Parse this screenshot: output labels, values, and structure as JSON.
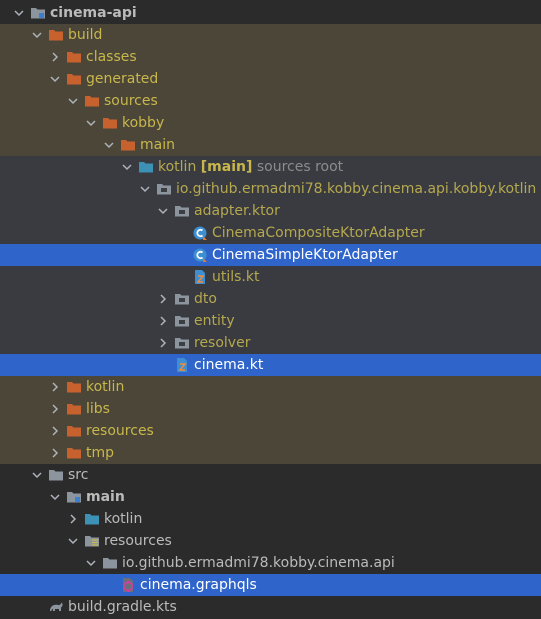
{
  "tree": {
    "root": {
      "label": "cinema-api"
    },
    "build": {
      "label": "build"
    },
    "classes": {
      "label": "classes"
    },
    "generated": {
      "label": "generated"
    },
    "sources": {
      "label": "sources"
    },
    "kobby": {
      "label": "kobby"
    },
    "main_gen": {
      "label": "main"
    },
    "kotlin_gen": {
      "label": "kotlin",
      "tag": "[main]",
      "hint": "sources root"
    },
    "package": {
      "label": "io.github.ermadmi78.kobby.cinema.api.kobby.kotlin"
    },
    "adapter_ktor": {
      "label": "adapter.ktor"
    },
    "composite_adapter": {
      "label": "CinemaCompositeKtorAdapter"
    },
    "simple_adapter": {
      "label": "CinemaSimpleKtorAdapter"
    },
    "utils": {
      "label": "utils.kt"
    },
    "dto": {
      "label": "dto"
    },
    "entity": {
      "label": "entity"
    },
    "resolver": {
      "label": "resolver"
    },
    "cinema_kt": {
      "label": "cinema.kt"
    },
    "kotlin_build": {
      "label": "kotlin"
    },
    "libs": {
      "label": "libs"
    },
    "resources_build": {
      "label": "resources"
    },
    "tmp": {
      "label": "tmp"
    },
    "src": {
      "label": "src"
    },
    "main_src": {
      "label": "main"
    },
    "kotlin_src": {
      "label": "kotlin"
    },
    "resources_src": {
      "label": "resources"
    },
    "res_package": {
      "label": "io.github.ermadmi78.kobby.cinema.api"
    },
    "graphqls": {
      "label": "cinema.graphqls"
    },
    "gradle": {
      "label": "build.gradle.kts"
    }
  },
  "colors": {
    "background": "#2b2b2b",
    "excluded_row": "#4b4638",
    "sources_row": "#393b40",
    "selection": "#2f65ca",
    "excluded_folder": "#c7612e",
    "folder": "#8c949e",
    "kotlin_folder": "#3c91b4",
    "text": "#bbbbbb",
    "excluded_text": "#c8b74c"
  }
}
